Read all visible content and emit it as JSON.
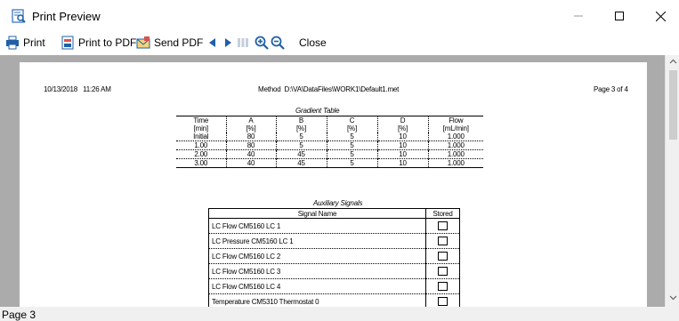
{
  "window": {
    "title": "Print Preview",
    "icon": "print-preview-icon"
  },
  "toolbar": {
    "print_label": "Print",
    "print_pdf_label": "Print to PDF",
    "send_pdf_label": "Send PDF",
    "close_label": "Close"
  },
  "page": {
    "date": "10/13/2018   11:26 AM",
    "method": "Method  D:\\VA\\DataFiles\\WORK1\\Default1.met",
    "page_of": "Page 3 of 4"
  },
  "gradient_table": {
    "title": "Gradient Table",
    "headers": [
      "Time",
      "A",
      "B",
      "C",
      "D",
      "Flow"
    ],
    "units": [
      "[min]",
      "[%]",
      "[%]",
      "[%]",
      "[%]",
      "[mL/min]"
    ],
    "rows": [
      [
        "Initial",
        "80",
        "5",
        "5",
        "10",
        "1.000"
      ],
      [
        "1.00",
        "80",
        "5",
        "5",
        "10",
        "1.000"
      ],
      [
        "2.00",
        "40",
        "45",
        "5",
        "10",
        "1.000"
      ],
      [
        "3.00",
        "40",
        "45",
        "5",
        "10",
        "1.000"
      ]
    ]
  },
  "auxiliary_signals": {
    "title": "Auxiliary Signals",
    "col_signal": "Signal Name",
    "col_stored": "Stored",
    "rows": [
      "LC Flow CM5160  LC 1",
      "LC Pressure CM5160  LC 1",
      "LC Flow CM5160  LC 2",
      "LC Flow CM5160  LC 3",
      "LC Flow CM5160  LC 4",
      "Temperature CM5310  Thermostat  0"
    ]
  },
  "status": {
    "text": "Page 3"
  },
  "colors": {
    "viewer_bg": "#ababab",
    "toolbar_icon_blue": "#1f5fa8",
    "status_bg": "#f0f0f0"
  }
}
